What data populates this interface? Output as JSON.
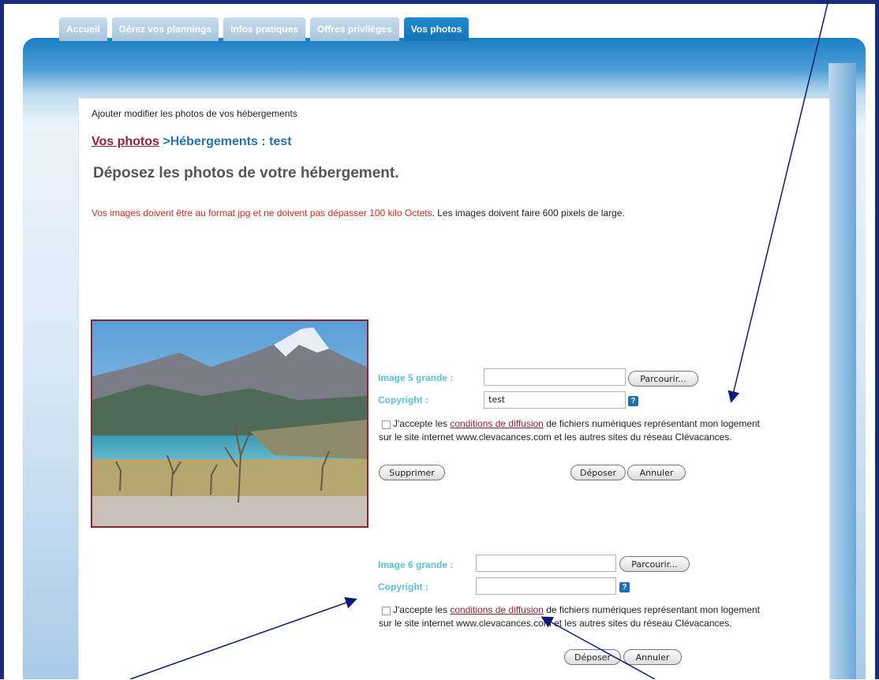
{
  "tabs": [
    {
      "label": "Accueil",
      "active": false
    },
    {
      "label": "Gérez vos plannings",
      "active": false
    },
    {
      "label": "Infos pratiques",
      "active": false
    },
    {
      "label": "Offres privilèges",
      "active": false
    },
    {
      "label": "Vos photos",
      "active": true
    }
  ],
  "page": {
    "subtitle": "Ajouter modifier les photos de vos hébergements",
    "breadcrumb_link": "Vos photos",
    "breadcrumb_rest": " >Hébergements : test",
    "heading": "Déposez les photos de votre hébergement.",
    "notice_red": "Vos images doivent être au format jpg et ne doivent pas dépasser 100 kilo Octets",
    "notice_rest": ". Les images doivent faire 600 pixels de large."
  },
  "image5": {
    "label": "Image 5 grande :",
    "file_value": "",
    "browse": "Parcourir...",
    "copyright_label": "Copyright :",
    "copyright_value": "test",
    "help": "?",
    "accept_before": "J'accepte les ",
    "accept_link": "conditions de diffusion",
    "accept_after": " de fichiers numériques représentant mon logement sur le site internet www.clevacances.com et les autres sites du réseau Clévacances.",
    "delete": "Supprimer",
    "submit": "Déposer",
    "cancel": "Annuler"
  },
  "image6": {
    "label": "Image 6 grande :",
    "file_value": "",
    "browse": "Parcourir...",
    "copyright_label": "Copyright :",
    "copyright_value": "",
    "help": "?",
    "accept_before": "J'accepte les ",
    "accept_link": "conditions de diffusion",
    "accept_after": " de fichiers numériques représentant mon logement sur le site internet www.clevacances.com et les autres sites du réseau Clévacances.",
    "submit": "Déposer",
    "cancel": "Annuler"
  },
  "colors": {
    "frame": "#1a2b7c",
    "tab_active": "#1474b5",
    "label": "#58c3d6",
    "link": "#9a1d33",
    "notice_red": "#d52b1e"
  }
}
